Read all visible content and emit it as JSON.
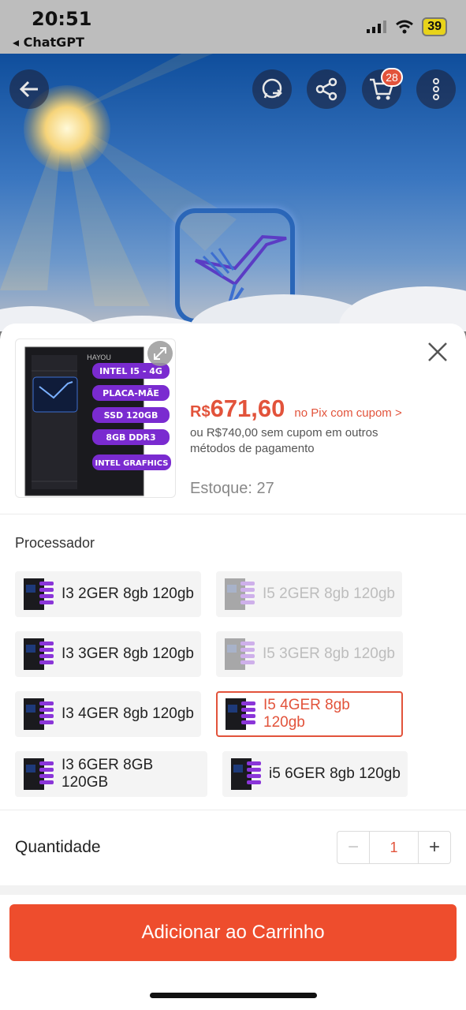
{
  "status_bar": {
    "time": "20:51",
    "back_app": "◂ ChatGPT",
    "battery": "39"
  },
  "hero": {
    "cart_count": "28"
  },
  "product": {
    "thumbnail_tags": [
      "INTEL I5 - 4G",
      "PLACA-MÃE",
      "SSD 120GB",
      "8GB DDR3",
      "INTEL GRAFHICS"
    ],
    "thumbnail_brand": "HAYOU",
    "price_currency": "R$",
    "price_value": "671,60",
    "price_note": "no Pix com cupom >",
    "alt_price": "ou R$740,00 sem cupom em outros métodos de pagamento",
    "stock": "Estoque: 27"
  },
  "variants": {
    "label": "Processador",
    "options": [
      {
        "label": "I3 2GER 8gb 120gb",
        "state": "normal"
      },
      {
        "label": "I5 2GER 8gb 120gb",
        "state": "disabled"
      },
      {
        "label": "I3 3GER 8gb 120gb",
        "state": "normal"
      },
      {
        "label": "I5 3GER 8gb 120gb",
        "state": "disabled"
      },
      {
        "label": "I3 4GER 8gb 120gb",
        "state": "normal"
      },
      {
        "label": "I5 4GER 8gb 120gb",
        "state": "selected"
      },
      {
        "label": "I3 6GER 8GB 120GB",
        "state": "normal"
      },
      {
        "label": "i5 6GER 8gb 120gb",
        "state": "normal"
      }
    ]
  },
  "quantity": {
    "label": "Quantidade",
    "value": "1",
    "minus": "−",
    "plus": "+"
  },
  "cta": {
    "label": "Adicionar ao Carrinho"
  },
  "colors": {
    "accent": "#ee4d2d",
    "price": "#e2533b"
  }
}
